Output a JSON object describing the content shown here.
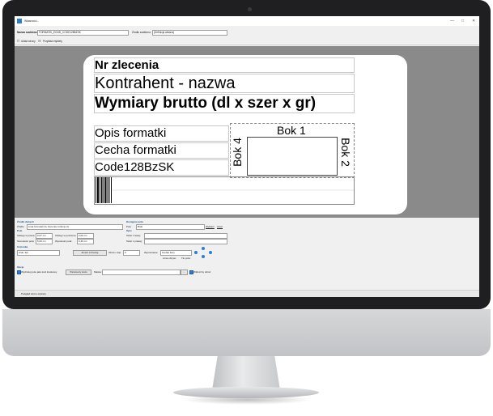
{
  "window": {
    "title": "Własności...",
    "minimize": "—",
    "maximize": "□",
    "close": "✕"
  },
  "name_row": {
    "label": "Nazwa szablonu:",
    "value": "FORMATKI_EGHD_CODE128BZSK",
    "source_label": "Źródło szablonu:",
    "source_value": "(Definicja własna)"
  },
  "toolbar": {
    "page_layout": "Układ strony",
    "preview": "Przykład etykiety"
  },
  "label": {
    "order": "Nr zlecenia",
    "contractor": "Kontrahent - nazwa",
    "dimensions": "Wymiary brutto (dl x szer x gr)",
    "description": "Opis formatki",
    "feature": "Cecha formatki",
    "barcode_text": "Code128BzSK",
    "side1": "Bok 1",
    "side2": "Bok 2",
    "side4": "Bok 4"
  },
  "panel": {
    "data_source_group": "Źródło danych",
    "source_label": "Źródło",
    "source_value": "Lista formatek do zlecenia rozkroju (I)",
    "available_fields_group": "Dostępne pola",
    "fields_label": "Pole",
    "fields_value": "Brak",
    "choose_button": "Wybierz",
    "remove_button": "Usuń",
    "field_group": "Pole",
    "offset_v_label": "Odstęp w pionie:",
    "offset_v_value": "0,07 cm",
    "offset_h_label": "Odstęp w poziomie:",
    "offset_h_value": "2,00 cm",
    "width_label": "Szerokość pola:",
    "width_value": "5,00 cm",
    "height_label": "Wysokość pola:",
    "height_value": "0,40 cm",
    "desc_group": "Opis",
    "left_text": "Tekst z lewej:",
    "right_text": "Tekst z prawej:",
    "font_group": "Czcionka",
    "font_value": "Arial, 9pt",
    "font_button": "Zmień czcionkę",
    "rotation_label": "Obrót o kąt:",
    "rotation_value": "0",
    "align_label": "Wyrównanie:",
    "align_value": "środek lewy",
    "frame_label": "Linia obrysu:",
    "fill_label": "Tło pola:",
    "options_group": "Opcje",
    "barcode_option": "Wydrukuj pole jako kod kreskowy",
    "barcode_params": "Parametry kodu",
    "mask_label": "Maska:",
    "visible_label": "Widoczny obraz",
    "ok_button": "OK",
    "cancel_button": "Anuluj",
    "status": "Podgląd wzoru etykiety"
  }
}
